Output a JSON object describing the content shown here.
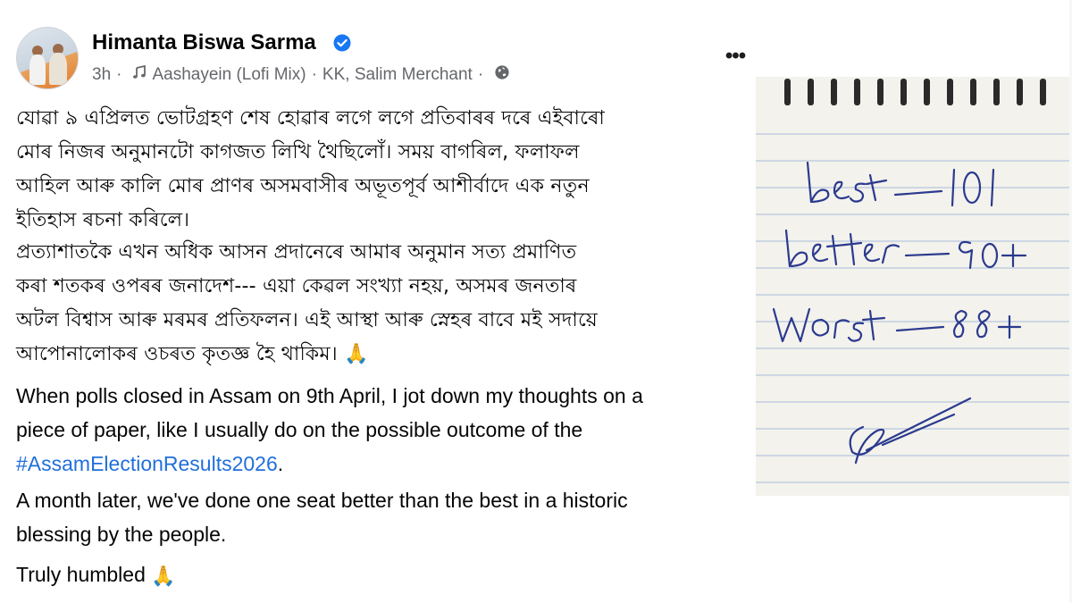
{
  "post": {
    "author_name": "Himanta Biswa Sarma",
    "verified_badge_icon": "verified-badge-icon",
    "time": "3h",
    "music_icon": "music-note-icon",
    "song": "Aashayein (Lofi Mix)",
    "artists": "KK, Salim Merchant",
    "privacy_icon": "globe-icon",
    "more_label": "•••",
    "bengali_paragraph_1": [
      "যোৱা ৯ এপ্ৰিলত ভোটগ্ৰহণ শেষ হোৱাৰ লগে লগে প্ৰতিবাৰৰ দৰে এইবাৰো",
      "মোৰ নিজৰ অনুমানটো কাগজত লিখি থৈছিলোঁ। সময় বাগৰিল, ফলাফল",
      "আহিল আৰু কালি মোৰ প্ৰাণৰ অসমবাসীৰ অভূতপূৰ্ব আশীৰ্বাদে এক নতুন",
      "ইতিহাস ৰচনা কৰিলে।"
    ],
    "bengali_paragraph_2": [
      "প্ৰত্যাশাতকৈ এখন অধিক আসন প্ৰদানেৰে আমাৰ অনুমান সত্য প্ৰমাণিত",
      "কৰা শতকৰ ওপৰৰ জনাদেশ--- এয়া কেৱল সংখ্যা নহয়, অসমৰ জনতাৰ",
      "অটল বিশ্বাস আৰু মৰমৰ প্ৰতিফলন। এই আস্থা আৰু স্নেহৰ বাবে মই সদায়ে",
      "আপোনালোকৰ ওচৰত কৃতজ্ঞ হৈ থাকিম।"
    ],
    "prayer_emoji": "🙏",
    "english_paragraph_1": [
      "When polls closed in Assam on 9th April, I jot down my thoughts on a",
      "piece of paper, like I usually do on the possible outcome of the"
    ],
    "hashtag": "#AssamElectionResults2026",
    "hashtag_suffix": ".",
    "english_paragraph_2": [
      "A month later, we've done one seat better than the best in a historic",
      "blessing by the people."
    ],
    "closing_text": "Truly humbled"
  },
  "note_photo": {
    "handwritten_lines": [
      "best - 101",
      "better - 90+",
      "worst - 88+"
    ],
    "signature": "signature"
  },
  "colors": {
    "hashtag": "#216fdb",
    "verified": "#1877f2",
    "meta_text": "#65676b",
    "ink": "#2a3a8c",
    "ruled_line": "#9fb4d8"
  }
}
